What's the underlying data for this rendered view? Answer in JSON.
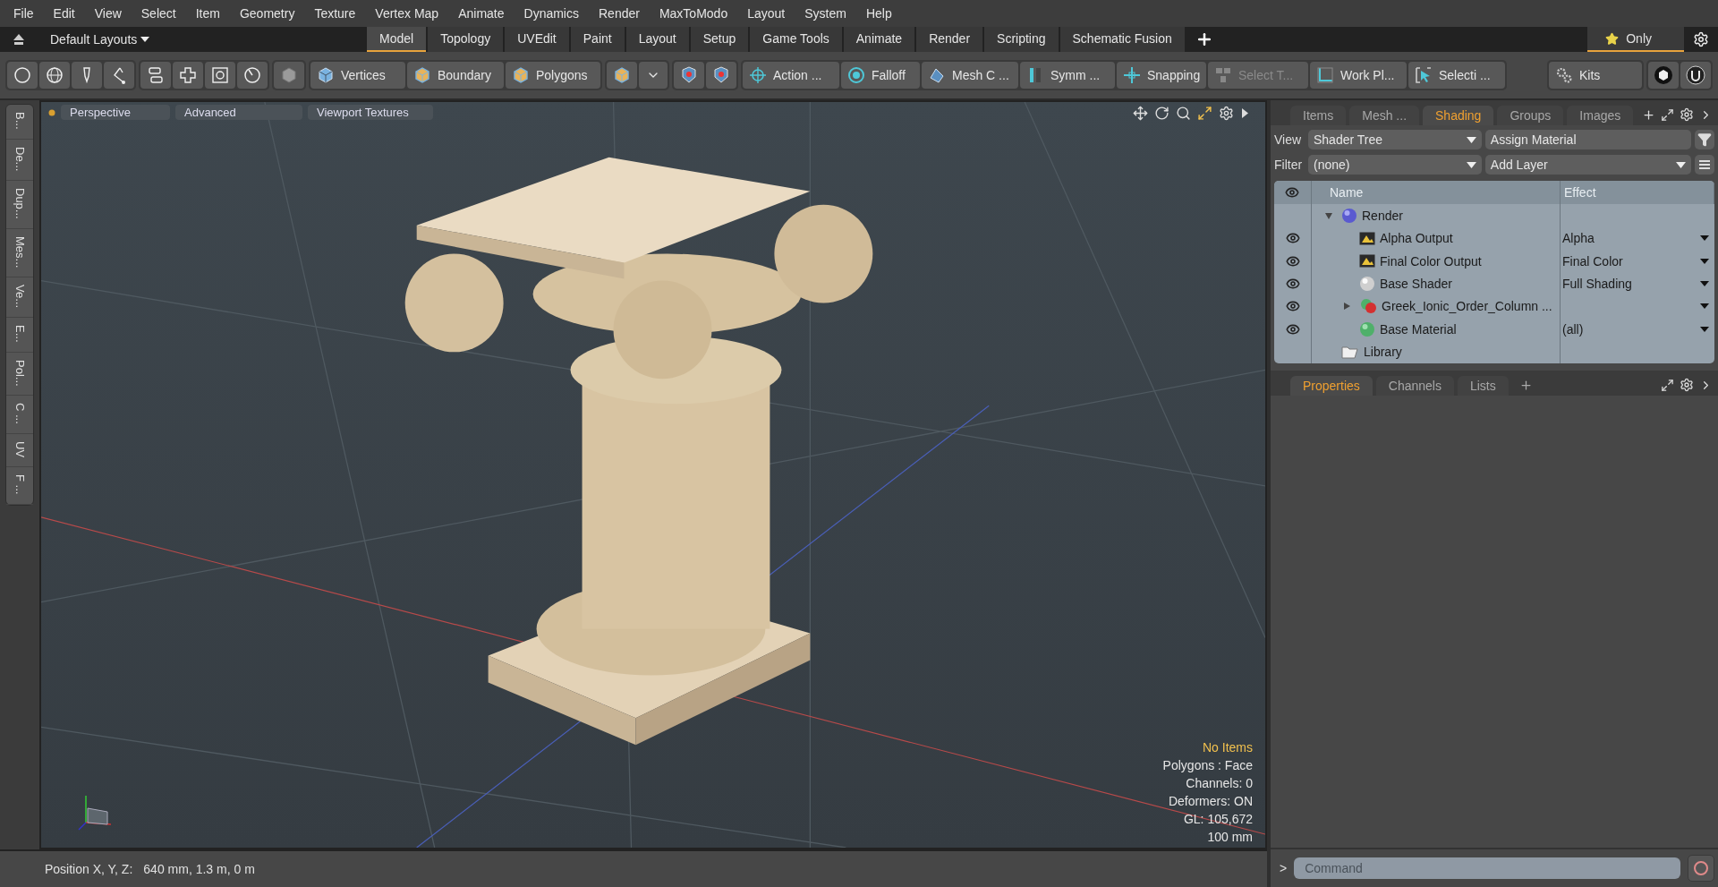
{
  "menu": [
    "File",
    "Edit",
    "View",
    "Select",
    "Item",
    "Geometry",
    "Texture",
    "Vertex Map",
    "Animate",
    "Dynamics",
    "Render",
    "MaxToModo",
    "Layout",
    "System",
    "Help"
  ],
  "layout_bar": {
    "title": "Default Layouts",
    "tabs": [
      {
        "label": "Model",
        "selected": true
      },
      {
        "label": "Topology",
        "selected": false
      },
      {
        "label": "UVEdit",
        "selected": false
      },
      {
        "label": "Paint",
        "selected": false
      },
      {
        "label": "Layout",
        "selected": false
      },
      {
        "label": "Setup",
        "selected": false
      },
      {
        "label": "Game Tools",
        "selected": false
      },
      {
        "label": "Animate",
        "selected": false
      },
      {
        "label": "Render",
        "selected": false
      },
      {
        "label": "Scripting",
        "selected": false
      },
      {
        "label": "Schematic Fusion",
        "selected": false
      }
    ],
    "filter": "Only"
  },
  "toolbar": [
    {
      "label": "Vertices",
      "disabled": false
    },
    {
      "label": "Boundary",
      "disabled": false
    },
    {
      "label": "Polygons",
      "disabled": false
    },
    {
      "label": "Action ...",
      "disabled": false
    },
    {
      "label": "Falloff",
      "disabled": false
    },
    {
      "label": "Mesh C ...",
      "disabled": false
    },
    {
      "label": "Symm ...",
      "disabled": false
    },
    {
      "label": "Snapping",
      "disabled": false
    },
    {
      "label": "Select T...",
      "disabled": true
    },
    {
      "label": "Work Pl...",
      "disabled": false
    },
    {
      "label": "Selecti ...",
      "disabled": false
    },
    {
      "label": "Kits",
      "disabled": false
    }
  ],
  "left_tabs": [
    "B...",
    "De...",
    "Dup...",
    "Mes...",
    "Ve...",
    "E...",
    "Pol...",
    "C ...",
    "UV",
    "F ..."
  ],
  "viewport": {
    "tabs": [
      "Perspective",
      "Advanced",
      "Viewport Textures"
    ],
    "info": [
      {
        "text": "No Items",
        "kind": "highlight"
      },
      {
        "text": "Polygons : Face",
        "kind": "plain"
      },
      {
        "text": "Channels: 0",
        "kind": "plain"
      },
      {
        "text": "Deformers: ON",
        "kind": "plain"
      },
      {
        "text": "GL: 105,672",
        "kind": "plain"
      },
      {
        "text": "100 mm",
        "kind": "plain"
      }
    ]
  },
  "shading_panel": {
    "tabs": [
      {
        "label": "Items",
        "selected": false
      },
      {
        "label": "Mesh ...",
        "selected": false
      },
      {
        "label": "Shading",
        "selected": true
      },
      {
        "label": "Groups",
        "selected": false
      },
      {
        "label": "Images",
        "selected": false
      }
    ],
    "view_label": "View",
    "view_value": "Shader Tree",
    "assign": "Assign Material",
    "filter_label": "Filter",
    "filter_value": "(none)",
    "add_layer": "Add Layer",
    "columns": [
      "Name",
      "Effect"
    ],
    "tree": [
      {
        "name": "Render",
        "kind": "render",
        "visible": false,
        "expanded": true,
        "children": [
          {
            "name": "Alpha Output",
            "effect": "Alpha",
            "kind": "output",
            "visible": true
          },
          {
            "name": "Final Color Output",
            "effect": "Final Color",
            "kind": "output",
            "visible": true
          },
          {
            "name": "Base Shader",
            "effect": "Full Shading",
            "kind": "shader",
            "visible": true
          },
          {
            "name": "Greek_Ionic_Order_Column ...",
            "kind": "group",
            "visible": true,
            "expanded": false
          },
          {
            "name": "Base Material",
            "effect": "(all)",
            "kind": "material",
            "visible": true
          }
        ]
      },
      {
        "name": "Library",
        "kind": "folder",
        "visible": false
      }
    ]
  },
  "properties_panel": {
    "tabs": [
      {
        "label": "Properties",
        "selected": true
      },
      {
        "label": "Channels",
        "selected": false
      },
      {
        "label": "Lists",
        "selected": false
      }
    ]
  },
  "command": {
    "prompt": ">",
    "placeholder": "Command"
  },
  "status_bar": {
    "label": "Position X, Y, Z:",
    "value": "640 mm, 1.3 m, 0 m"
  }
}
